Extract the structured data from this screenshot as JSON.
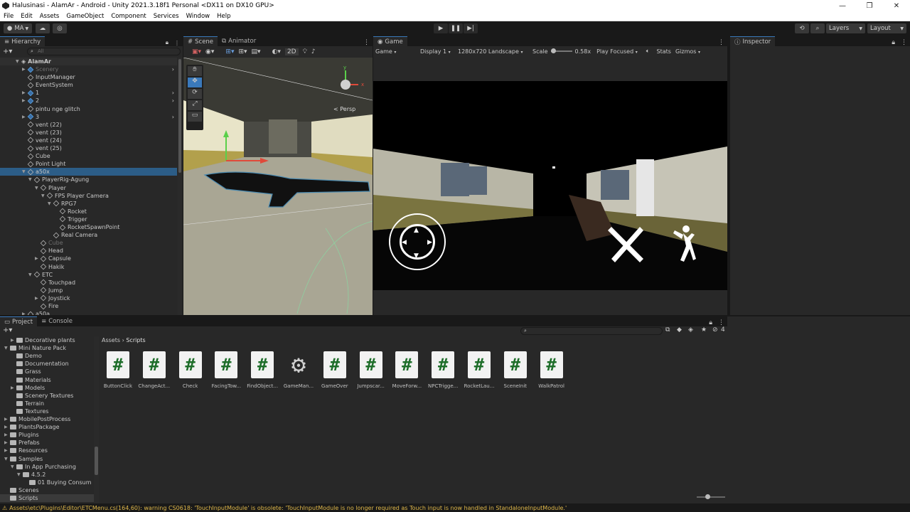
{
  "window": {
    "title": "Halusinasi - AlamAr - Android - Unity 2021.3.18f1 Personal <DX11 on DX10 GPU>",
    "minimize": "—",
    "maximize": "❐",
    "close": "✕"
  },
  "menu": [
    "File",
    "Edit",
    "Assets",
    "GameObject",
    "Component",
    "Services",
    "Window",
    "Help"
  ],
  "toolbar": {
    "account": "MA",
    "layers": "Layers",
    "layout": "Layout"
  },
  "hierarchy": {
    "tab": "Hierarchy",
    "search_placeholder": "All",
    "scene": "AlamAr",
    "items": [
      {
        "label": "Scenery",
        "dim": true,
        "blue": true,
        "arrow": true,
        "indent": 1
      },
      {
        "label": "InputManager",
        "indent": 1
      },
      {
        "label": "EventSystem",
        "indent": 1
      },
      {
        "label": "1",
        "blue": true,
        "arrow": true,
        "indent": 1
      },
      {
        "label": "2",
        "blue": true,
        "arrow": true,
        "indent": 1
      },
      {
        "label": "pintu nge glitch",
        "indent": 1
      },
      {
        "label": "3",
        "blue": true,
        "arrow": true,
        "indent": 1
      },
      {
        "label": "vent (22)",
        "indent": 1
      },
      {
        "label": "vent (23)",
        "indent": 1
      },
      {
        "label": "vent (24)",
        "indent": 1
      },
      {
        "label": "vent (25)",
        "indent": 1
      },
      {
        "label": "Cube",
        "indent": 1
      },
      {
        "label": "Point Light",
        "indent": 1
      },
      {
        "label": "a50x",
        "indent": 1,
        "selected": true,
        "open": true
      },
      {
        "label": "PlayerRig-Agung",
        "indent": 2,
        "open": true
      },
      {
        "label": "Player",
        "indent": 3,
        "open": true
      },
      {
        "label": "FPS Player Camera",
        "indent": 4,
        "open": true
      },
      {
        "label": "RPG7",
        "indent": 5,
        "open": true
      },
      {
        "label": "Rocket",
        "indent": 6
      },
      {
        "label": "Trigger",
        "indent": 6
      },
      {
        "label": "RocketSpawnPoint",
        "indent": 6
      },
      {
        "label": "Real Camera",
        "indent": 5
      },
      {
        "label": "Cube",
        "indent": 3,
        "dim": true
      },
      {
        "label": "Head",
        "indent": 3
      },
      {
        "label": "Capsule",
        "indent": 3,
        "arrow": true
      },
      {
        "label": "Hakik",
        "indent": 3
      },
      {
        "label": "ETC",
        "indent": 2,
        "open": true
      },
      {
        "label": "Touchpad",
        "indent": 3
      },
      {
        "label": "Jump",
        "indent": 3
      },
      {
        "label": "Joystick",
        "indent": 3,
        "arrow": true
      },
      {
        "label": "Fire",
        "indent": 3
      },
      {
        "label": "a50a",
        "indent": 1,
        "arrow": true
      }
    ]
  },
  "scene_view": {
    "tabs": [
      "Scene",
      "Animator"
    ],
    "mode": "2D",
    "persp": "< Persp",
    "gizmo_y": "y",
    "gizmo_x": "x"
  },
  "game_view": {
    "tab": "Game",
    "display": "Game",
    "display_num": "Display 1",
    "resolution": "1280x720 Landscape",
    "scale_label": "Scale",
    "scale_value": "0.58x",
    "play_focused": "Play Focused",
    "stats": "Stats",
    "gizmos": "Gizmos"
  },
  "inspector": {
    "tab": "Inspector"
  },
  "project": {
    "tabs": [
      "Project",
      "Console"
    ],
    "count": "4",
    "breadcrumb": [
      "Assets",
      "Scripts"
    ],
    "folders": [
      {
        "label": "Decorative plants",
        "indent": 2,
        "arrow": true
      },
      {
        "label": "Mini Nature Pack",
        "indent": 1,
        "open": true
      },
      {
        "label": "Demo",
        "indent": 2
      },
      {
        "label": "Documentation",
        "indent": 2
      },
      {
        "label": "Grass",
        "indent": 2
      },
      {
        "label": "Materials",
        "indent": 2
      },
      {
        "label": "Models",
        "indent": 2,
        "arrow": true
      },
      {
        "label": "Scenery Textures",
        "indent": 2
      },
      {
        "label": "Terrain",
        "indent": 2
      },
      {
        "label": "Textures",
        "indent": 2
      },
      {
        "label": "MobilePostProcess",
        "indent": 1,
        "arrow": true
      },
      {
        "label": "PlantsPackage",
        "indent": 1,
        "arrow": true
      },
      {
        "label": "Plugins",
        "indent": 1,
        "arrow": true
      },
      {
        "label": "Prefabs",
        "indent": 1,
        "arrow": true
      },
      {
        "label": "Resources",
        "indent": 1,
        "arrow": true
      },
      {
        "label": "Samples",
        "indent": 1,
        "open": true
      },
      {
        "label": "In App Purchasing",
        "indent": 2,
        "open": true
      },
      {
        "label": "4.5.2",
        "indent": 3,
        "open": true
      },
      {
        "label": "01 Buying Consum",
        "indent": 4
      },
      {
        "label": "Scenes",
        "indent": 1
      },
      {
        "label": "Scripts",
        "indent": 1,
        "selected": true
      }
    ],
    "assets": [
      {
        "label": "ButtonClick",
        "kind": "script"
      },
      {
        "label": "ChangeAct...",
        "kind": "script"
      },
      {
        "label": "Check",
        "kind": "script"
      },
      {
        "label": "FacingTow...",
        "kind": "script"
      },
      {
        "label": "FindObject...",
        "kind": "script"
      },
      {
        "label": "GameMan...",
        "kind": "gear"
      },
      {
        "label": "GameOver",
        "kind": "script"
      },
      {
        "label": "Jumpscar...",
        "kind": "script"
      },
      {
        "label": "MoveForw...",
        "kind": "script"
      },
      {
        "label": "NPCTrigge...",
        "kind": "script"
      },
      {
        "label": "RocketLau...",
        "kind": "script"
      },
      {
        "label": "SceneInit",
        "kind": "script"
      },
      {
        "label": "WalkPatrol",
        "kind": "script"
      }
    ],
    "hash_glyph": "#"
  },
  "status": {
    "message": "Assets\\etc\\Plugins\\Editor\\ETCMenu.cs(164,60): warning CS0618: 'TouchInputModule' is obsolete: 'TouchInputModule is no longer required as Touch input is now handled in StandaloneInputModule.'"
  },
  "colors": {
    "selection": "#2c5d87",
    "accent": "#3a79bb",
    "warning": "#e0b84a",
    "script_green": "#1e6e2a"
  }
}
